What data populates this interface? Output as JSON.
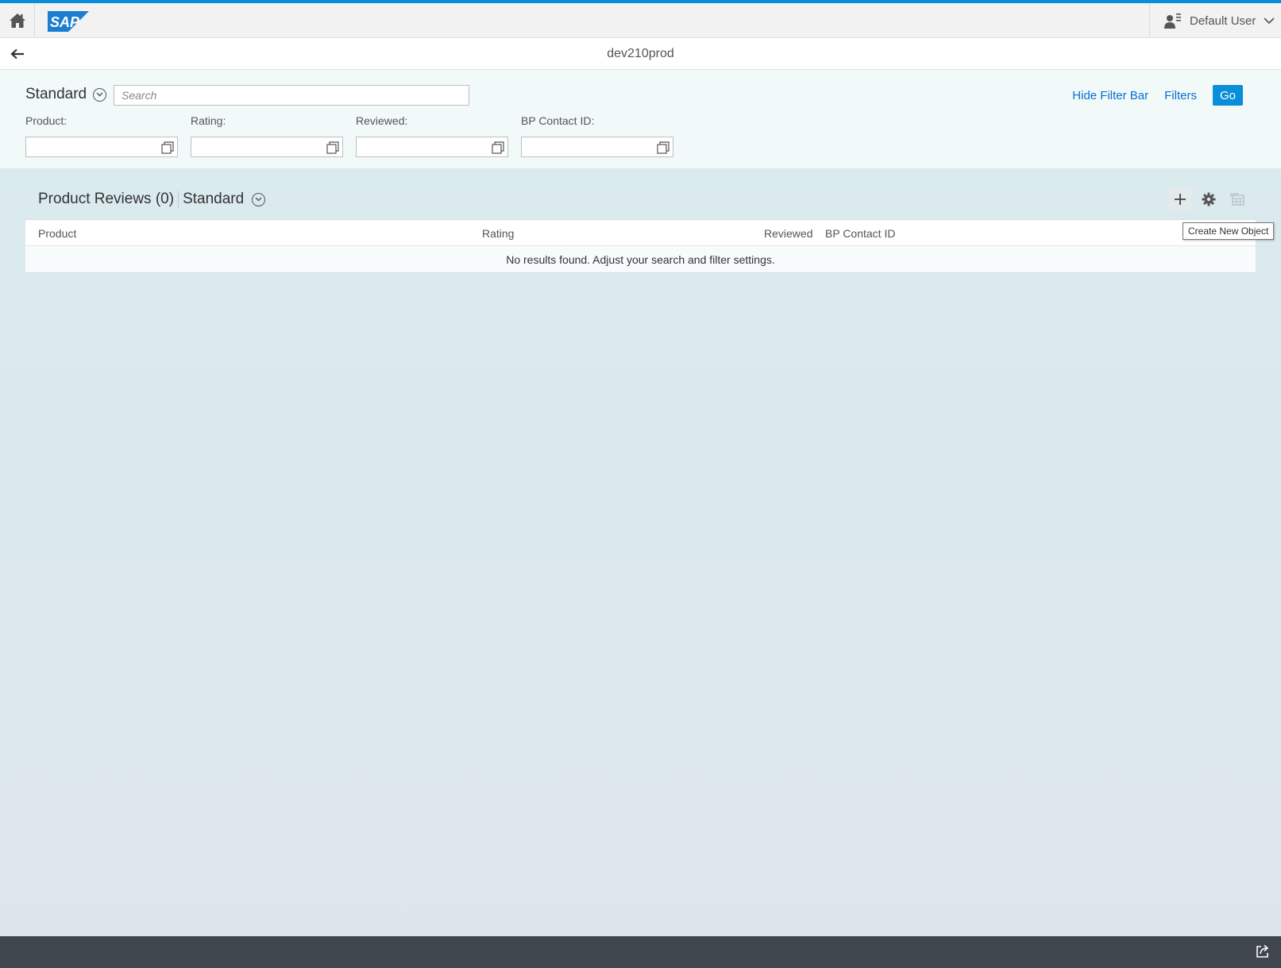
{
  "shell": {
    "user_name": "Default User",
    "logo_text": "SAP"
  },
  "titlebar": {
    "title": "dev210prod"
  },
  "filterbar": {
    "variant": "Standard",
    "search_placeholder": "Search",
    "hide_filter_bar": "Hide Filter Bar",
    "filters": "Filters",
    "go": "Go",
    "fields": [
      {
        "label": "Product:",
        "value": ""
      },
      {
        "label": "Rating:",
        "value": ""
      },
      {
        "label": "Reviewed:",
        "value": ""
      },
      {
        "label": "BP Contact ID:",
        "value": ""
      }
    ]
  },
  "table": {
    "title": "Product Reviews (0)",
    "variant": "Standard",
    "columns": [
      "Product",
      "Rating",
      "Reviewed",
      "BP Contact ID"
    ],
    "empty_text": "No results found. Adjust your search and filter settings.",
    "tooltip": "Create New Object"
  },
  "colors": {
    "accent": "#0a8ed9",
    "link": "#0a6ed1",
    "footer": "#3f464d"
  }
}
